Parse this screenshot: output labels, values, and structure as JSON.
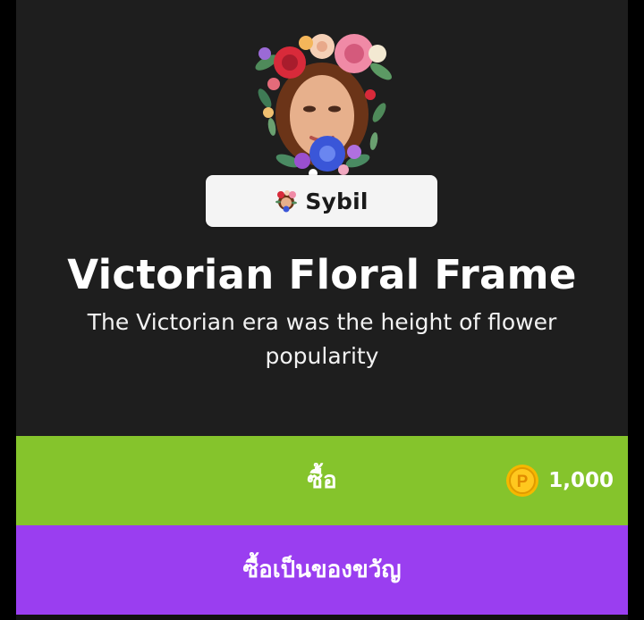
{
  "item": {
    "name": "Sybil",
    "title": "Victorian Floral Frame",
    "description": "The Victorian era was the height of flower popularity",
    "thumbnail_icon": "floral-portrait"
  },
  "buy": {
    "label": "ซื้อ",
    "price": "1,000",
    "currency_icon": "coin-p-icon"
  },
  "gift": {
    "label": "ซื้อเป็นของขวัญ"
  },
  "colors": {
    "panel": "#1e1e1e",
    "buy_button": "#85c42c",
    "gift_button": "#9a3ef0",
    "coin": "#f5b800",
    "chip": "#f4f4f4"
  }
}
